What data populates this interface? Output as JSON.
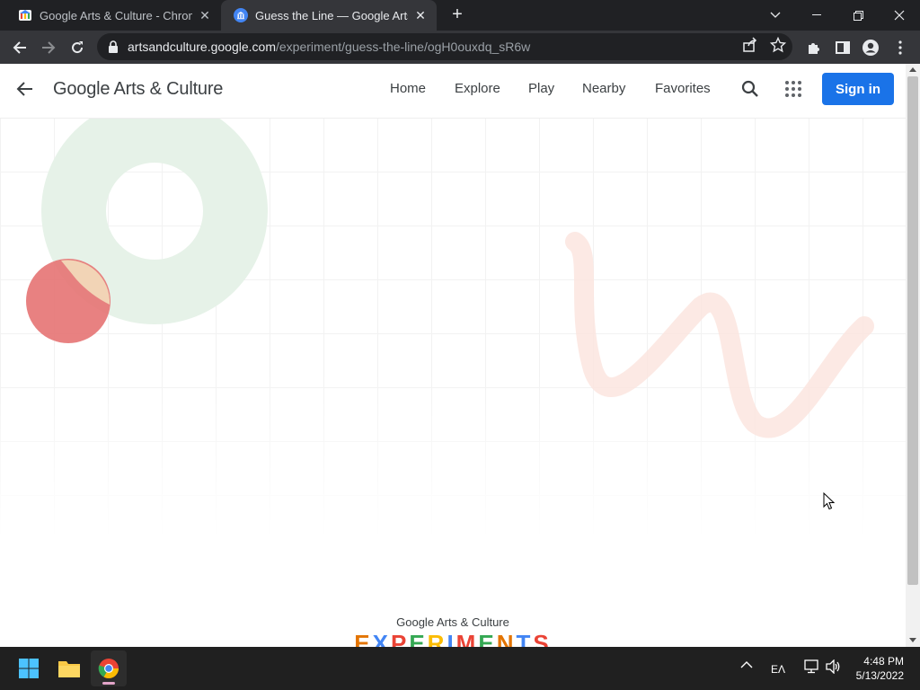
{
  "browser": {
    "tabs": [
      {
        "title": "Google Arts & Culture - Chrome",
        "active": false
      },
      {
        "title": "Guess the Line — Google Arts &",
        "active": true
      }
    ],
    "url_host": "artsandculture.google.com",
    "url_path": "/experiment/guess-the-line/ogH0ouxdq_sR6w"
  },
  "header": {
    "brand": "Google Arts & Culture",
    "nav": [
      "Home",
      "Explore",
      "Play",
      "Nearby",
      "Favorites"
    ],
    "signin_label": "Sign in"
  },
  "footer": {
    "logo_text": "Google Arts & Culture",
    "experiments_letters": [
      "E",
      "X",
      "P",
      "E",
      "R",
      "I",
      "M",
      "E",
      "N",
      "T",
      "S"
    ],
    "experiments_colors": [
      "#e37400",
      "#4285f4",
      "#ea4335",
      "#34a853",
      "#fbbc04",
      "#4285f4",
      "#ea4335",
      "#34a853",
      "#e37400",
      "#4285f4",
      "#ea4335"
    ]
  },
  "taskbar": {
    "lang": "ΕΛ",
    "time": "4:48 PM",
    "date": "5/13/2022"
  },
  "colors": {
    "accent": "#1a73e8",
    "chrome_dark": "#202124",
    "chrome_toolbar": "#35363a",
    "decor_circle_red": "#e57373",
    "decor_ring_green": "#e6f2e8",
    "decor_squiggle": "#fbe3dd"
  }
}
